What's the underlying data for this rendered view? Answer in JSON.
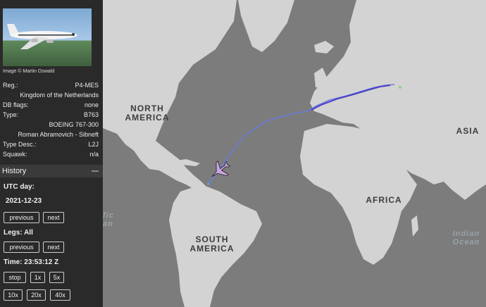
{
  "aircraft": {
    "photo_credit": "Image © Martin Oswald",
    "reg_label": "Reg.:",
    "reg_value": "P4-MES",
    "country": "Kingdom of the Netherlands",
    "db_flags_label": "DB flags:",
    "db_flags_value": "none",
    "type_label": "Type:",
    "type_value": "B763",
    "type_full": "BOEING 767-300",
    "owner": "Roman Abramovich - Sibneft",
    "type_desc_label": "Type Desc.:",
    "type_desc_value": "L2J",
    "squawk_label": "Squawk:",
    "squawk_value": "n/a"
  },
  "history": {
    "title": "History",
    "utc_day_label": "UTC day:",
    "utc_day_value": "2021-12-23",
    "previous_day_label": "previous",
    "next_day_label": "next",
    "legs_label": "Legs: All",
    "previous_leg_label": "previous",
    "next_leg_label": "next",
    "time_label": "Time: 23:53:12 Z",
    "stop_label": "stop",
    "speed_1x": "1x",
    "speed_5x": "5x",
    "speed_10x": "10x",
    "speed_20x": "20x",
    "speed_40x": "40x"
  },
  "map": {
    "labels": {
      "north_america_1": "NORTH",
      "north_america_2": "AMERICA",
      "south_america_1": "SOUTH",
      "south_america_2": "AMERICA",
      "africa": "AFRICA",
      "asia": "ASIA",
      "pacific_partial_1": "fic",
      "pacific_partial_2": "an",
      "indian_ocean_1": "Indian",
      "indian_ocean_2": "Ocean"
    },
    "colors": {
      "ocean": "#7c7c7c",
      "land": "#d3d3d3",
      "track_start": "#6a7bd8",
      "track_end": "#4a3fc8",
      "aircraft_icon": "#c9a6e0"
    }
  }
}
